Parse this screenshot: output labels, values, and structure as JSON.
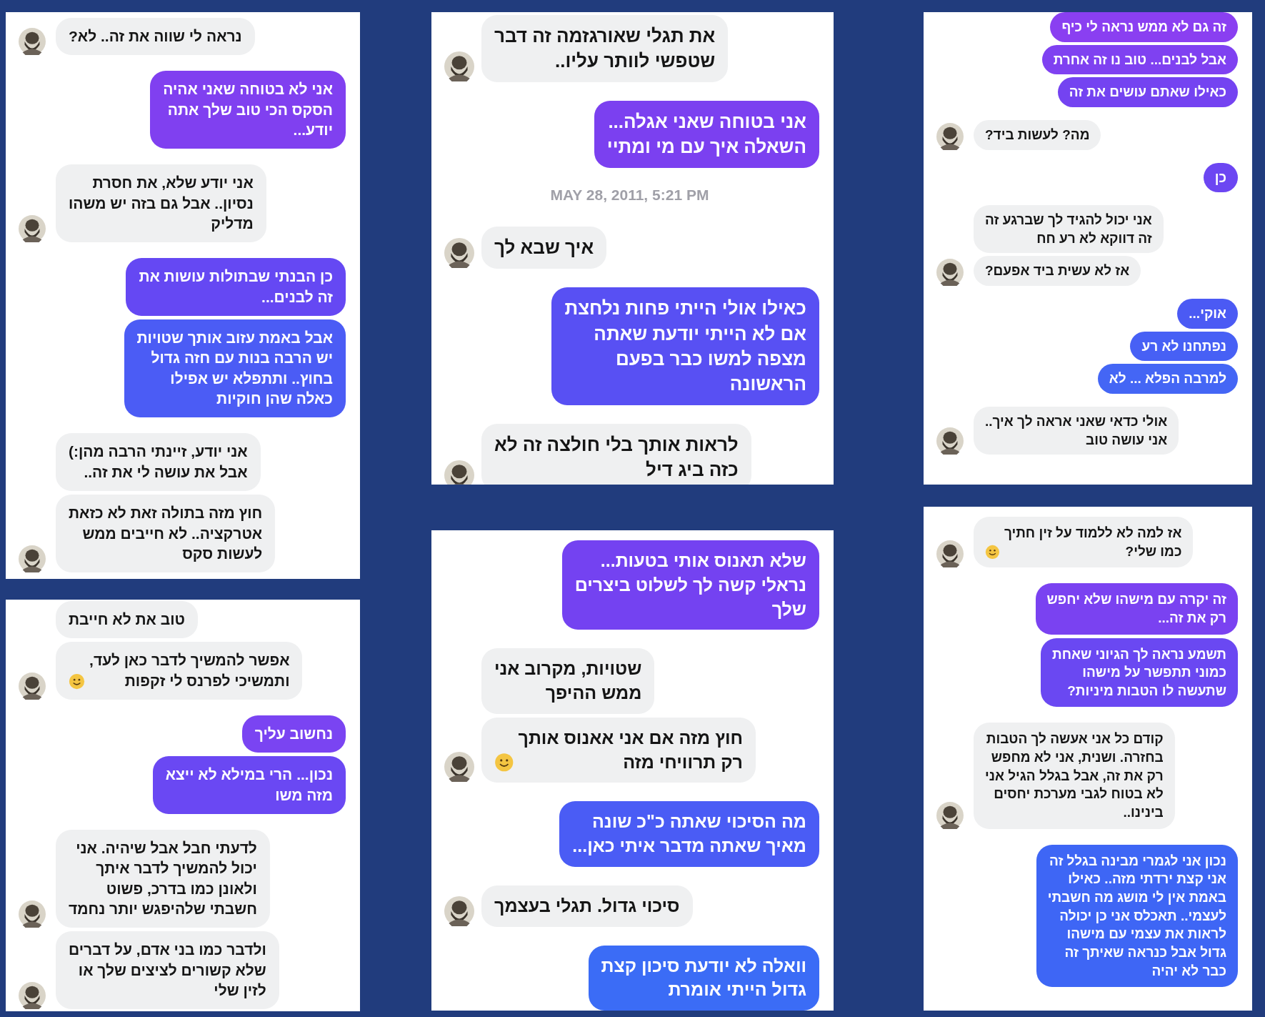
{
  "columns": [
    {
      "panels": [
        {
          "messages": [
            {
              "kind": "out",
              "color": "#8a3ff1",
              "text": "זה גם לא ממש נראה לי כיף"
            },
            {
              "kind": "out",
              "color": "#7f41f1",
              "text": "אבל לבנים... טוב נו זה אחרת"
            },
            {
              "kind": "out",
              "color": "#7443f1",
              "text": "כאילו שאתם עושים את זה"
            },
            {
              "kind": "in",
              "avatar": true,
              "text": "מה? לעשות ביד?"
            },
            {
              "kind": "out",
              "color": "#6c46f2",
              "text": "כן"
            },
            {
              "kind": "in",
              "avatar": false,
              "text": "אני יכול להגיד לך שברגע זה\nזה דווקא לא רע חח"
            },
            {
              "kind": "in",
              "avatar": true,
              "text": "אז לא עשית ביד אפעם?"
            },
            {
              "kind": "out",
              "color": "#4b5af4",
              "text": "אוקי..."
            },
            {
              "kind": "out",
              "color": "#4760f5",
              "text": "נפתחנו לא רע"
            },
            {
              "kind": "out",
              "color": "#4466f5",
              "text": "למרבה הפלא ... לא"
            },
            {
              "kind": "in",
              "avatar": true,
              "text": "אולי כדאי שאני אראה לך איך..\nאני עושה טוב"
            }
          ]
        },
        {
          "messages": [
            {
              "kind": "in",
              "avatar": true,
              "smiley": true,
              "text": "אז למה לא ללמוד על זין חתיך\nכמו שלי?"
            },
            {
              "kind": "out",
              "color": "#7a42f1",
              "text": "זה יקרה עם מישהו שלא יחפש\nרק את זה..."
            },
            {
              "kind": "out",
              "color": "#6a48f2",
              "text": "תשמע נראה לך הגיוני שאחת\nכמוני תתפשר על מישהו\nשתעשה לו הטבות מיניות?"
            },
            {
              "kind": "in",
              "avatar": true,
              "text": "קודם כל אני אעשה לך הטבות\nבחזרה. ושנית, אני לא מחפש\nרק את זה, אבל בגלל הגיל אני\nלא בטוח לגבי מערכת יחסים\nבינינו.."
            },
            {
              "kind": "out",
              "color": "#3e66f5",
              "text": "נכון אני לגמרי מבינה בגלל זה\nאני קצת ירדתי מזה.. כאילו\nבאמת אין לי מושג מה חשבתי\nלעצמי.. תאכלס אני כן יכולה\nלראות את עצמי עם מישהו\nגדול אבל כנראה שאיתך זה\nכבר לא יהיה"
            }
          ]
        }
      ]
    },
    {
      "panels": [
        {
          "messages": [
            {
              "kind": "in",
              "avatar": true,
              "text": "את תגלי שאורגזמה זה דבר\nשטפשי לוותר עליו.."
            },
            {
              "kind": "out",
              "color": "#7b40f0",
              "text": "אני בטוחה שאני אגלה...\nהשאלה איך עם מי ומתיי"
            },
            {
              "kind": "time",
              "text": "MAY 28, 2011, 5:21 PM"
            },
            {
              "kind": "in",
              "avatar": true,
              "text": "איך שבא לך"
            },
            {
              "kind": "out",
              "color": "#5850f3",
              "text": "כאילו אולי הייתי פחות נלחצת\nאם לא הייתי יודעת שאתה\nמצפה למשו כבר בפעם\nהראשונה"
            },
            {
              "kind": "in",
              "avatar": true,
              "text": "לראות אותך בלי חולצה זה לא\nכזה ביג דיל"
            }
          ]
        },
        {
          "messages": [
            {
              "kind": "out",
              "color": "#7442f1",
              "text": "שלא תאנוס אותי בטעות...\nנראלי קשה לך לשלוט ביצרים\nשלך"
            },
            {
              "kind": "in",
              "avatar": false,
              "text": "שטויות, מקרוב אני\nממש ההיפך"
            },
            {
              "kind": "in",
              "avatar": true,
              "smiley": true,
              "text": "חוץ מזה אם אני אאנוס אותך\nרק תרוויחי מזה"
            },
            {
              "kind": "out",
              "color": "#4a5cf5",
              "text": "מה הסיכוי שאתה כ\"כ שונה\nמאיך שאתה מדבר איתי כאן..."
            },
            {
              "kind": "in",
              "avatar": true,
              "text": "סיכוי גדול. תגלי בעצמך"
            },
            {
              "kind": "out",
              "color": "#3b6cf6",
              "text": "וואלה לא יודעת סיכון קצת\nגדול הייתי אומרת"
            }
          ]
        }
      ]
    },
    {
      "panels": [
        {
          "messages": [
            {
              "kind": "in",
              "avatar": true,
              "text": "נראה לי שווה את זה.. לא?"
            },
            {
              "kind": "out",
              "color": "#8040f0",
              "text": "אני לא בטוחה שאני אהיה\nהסקס הכי טוב שלך אתה\nיודע..."
            },
            {
              "kind": "in",
              "avatar": true,
              "text": "אני יודע שלא, את חסרת\nנסיון.. אבל גם בזה יש משהו\nמדליק"
            },
            {
              "kind": "out",
              "color": "#6548f3",
              "text": "כן הבנתי שבתולות עושות את\nזה לבנים..."
            },
            {
              "kind": "out",
              "color": "#4b5cf5",
              "text": "אבל באמת עזוב אותך שטויות\nיש הרבה בנות עם חזה גדול\nבחוץ.. ותתפלא יש אפילו\nכאלה שהן חוקיות"
            },
            {
              "kind": "in",
              "avatar": false,
              "text": "אני יודע, זיינתי הרבה מהן:)\nאבל את עושה לי את זה.."
            },
            {
              "kind": "in",
              "avatar": true,
              "text": "חוץ מזה בתולה זאת לא כזאת\nאטרקציה.. לא חייבים ממש\nלעשות סקס"
            }
          ]
        },
        {
          "messages": [
            {
              "kind": "in",
              "avatar": false,
              "text": "טוב את לא חייבת"
            },
            {
              "kind": "in",
              "avatar": true,
              "smiley": true,
              "text": "אפשר להמשיך לדבר כאן לעד,\nותמשיכי לפרנס לי זקפות"
            },
            {
              "kind": "out",
              "color": "#7a44f2",
              "text": "נחשוב עליך"
            },
            {
              "kind": "out",
              "color": "#6a48f3",
              "text": "נכון... הרי במילא לא ייצא\nמזה משו"
            },
            {
              "kind": "in",
              "avatar": true,
              "text": "לדעתי חבל אבל שיהיה. אני\nיכול להמשיך לדבר איתך\nולאונן כמו בדרכ, פשוט\nחשבתי שלהיפגש יותר נחמד"
            },
            {
              "kind": "in",
              "avatar": true,
              "text": "ולדבר כמו בני אדם, על דברים\nשלא קשורים לציצים שלך או\nלזין שלי"
            }
          ]
        }
      ]
    }
  ]
}
